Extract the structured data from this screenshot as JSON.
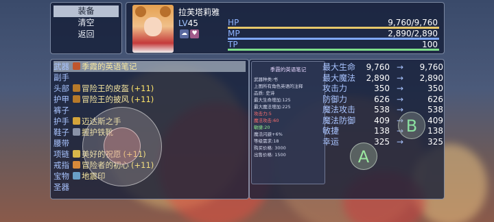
{
  "menu": {
    "items": [
      "装备",
      "清空",
      "返回"
    ],
    "selected": 0
  },
  "actor": {
    "name": "拉芙塔莉雅",
    "level_label": "LV",
    "level": "45",
    "state_icons": [
      "cloud-icon",
      "heart-icon"
    ],
    "hp": {
      "label": "HP",
      "text": "9,760/9,760",
      "fraction": 1.0,
      "color": "#e8c86a"
    },
    "mp": {
      "label": "MP",
      "text": "2,890/2,890",
      "fraction": 1.0,
      "color": "#7fa8ff"
    },
    "tp": {
      "label": "TP",
      "text": "100",
      "fraction": 1.0,
      "color": "#7fe08a"
    }
  },
  "slots": [
    {
      "slot": "武器",
      "item": "季霞的英语笔记",
      "plus": "",
      "icon": "book-icon",
      "icon_color": "#c0552c"
    },
    {
      "slot": "副手",
      "item": "",
      "plus": "",
      "icon": "",
      "icon_color": ""
    },
    {
      "slot": "头部",
      "item": "冒险王的皮盔",
      "plus": "(+11)",
      "icon": "helmet-icon",
      "icon_color": "#b77a2a"
    },
    {
      "slot": "护甲",
      "item": "冒险王的披风",
      "plus": "(+11)",
      "icon": "cloak-icon",
      "icon_color": "#b77a2a"
    },
    {
      "slot": "裤子",
      "item": "",
      "plus": "",
      "icon": "",
      "icon_color": ""
    },
    {
      "slot": "护手",
      "item": "迈达斯之手",
      "plus": "",
      "icon": "glove-icon",
      "icon_color": "#d4a43a"
    },
    {
      "slot": "鞋子",
      "item": "握护铁靴",
      "plus": "",
      "icon": "boot-icon",
      "icon_color": "#8a93a8"
    },
    {
      "slot": "腰带",
      "item": "",
      "plus": "",
      "icon": "",
      "icon_color": ""
    },
    {
      "slot": "项链",
      "item": "美好的祝愿",
      "plus": "(+11)",
      "icon": "necklace-icon",
      "icon_color": "#d9b84a"
    },
    {
      "slot": "戒指",
      "item": "冒险者的初心",
      "plus": "(+11)",
      "icon": "ring-icon",
      "icon_color": "#d88a3a"
    },
    {
      "slot": "宝物",
      "item": "地震印",
      "plus": "",
      "icon": "seal-icon",
      "icon_color": "#6aa0c8"
    },
    {
      "slot": "圣器",
      "item": "",
      "plus": "",
      "icon": "",
      "icon_color": ""
    }
  ],
  "item_info": {
    "title": "季霞的英语笔记",
    "lines": [
      {
        "text": "武器种类:书",
        "tone": ""
      },
      {
        "text": "上图所有角色英语的注释",
        "tone": ""
      },
      {
        "text": "品质: 史诗",
        "tone": ""
      },
      {
        "text": "最大生命增加:125",
        "tone": ""
      },
      {
        "text": "最大魔法增加:225",
        "tone": ""
      },
      {
        "text": "攻击力:5",
        "tone": "red"
      },
      {
        "text": "魔法攻击:60",
        "tone": "red"
      },
      {
        "text": "敏捷:20",
        "tone": "grn"
      },
      {
        "text": "魔法闪避+6%",
        "tone": ""
      },
      {
        "text": "等级需求:18",
        "tone": ""
      },
      {
        "text": "购买价格: 3000",
        "tone": ""
      },
      {
        "text": "出售价格: 1500",
        "tone": ""
      }
    ]
  },
  "stats": [
    {
      "name": "最大生命",
      "cur": "9,760",
      "new": "9,760"
    },
    {
      "name": "最大魔法",
      "cur": "2,890",
      "new": "2,890"
    },
    {
      "name": "攻击力",
      "cur": "350",
      "new": "350"
    },
    {
      "name": "防御力",
      "cur": "626",
      "new": "626"
    },
    {
      "name": "魔法攻击",
      "cur": "538",
      "new": "538"
    },
    {
      "name": "魔法防御",
      "cur": "409",
      "new": "409"
    },
    {
      "name": "敏捷",
      "cur": "138",
      "new": "138"
    },
    {
      "name": "幸运",
      "cur": "325",
      "new": "325"
    }
  ],
  "arrow": "→",
  "pad": {
    "a": "A",
    "b": "B"
  }
}
